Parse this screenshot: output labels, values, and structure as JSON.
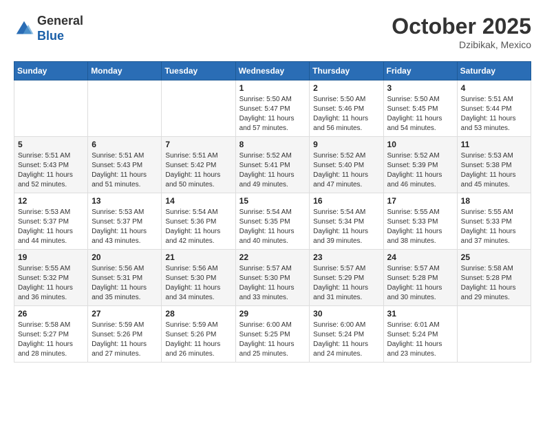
{
  "header": {
    "logo_line1": "General",
    "logo_line2": "Blue",
    "month": "October 2025",
    "location": "Dzibikak, Mexico"
  },
  "weekdays": [
    "Sunday",
    "Monday",
    "Tuesday",
    "Wednesday",
    "Thursday",
    "Friday",
    "Saturday"
  ],
  "weeks": [
    [
      {
        "day": "",
        "info": ""
      },
      {
        "day": "",
        "info": ""
      },
      {
        "day": "",
        "info": ""
      },
      {
        "day": "1",
        "info": "Sunrise: 5:50 AM\nSunset: 5:47 PM\nDaylight: 11 hours\nand 57 minutes."
      },
      {
        "day": "2",
        "info": "Sunrise: 5:50 AM\nSunset: 5:46 PM\nDaylight: 11 hours\nand 56 minutes."
      },
      {
        "day": "3",
        "info": "Sunrise: 5:50 AM\nSunset: 5:45 PM\nDaylight: 11 hours\nand 54 minutes."
      },
      {
        "day": "4",
        "info": "Sunrise: 5:51 AM\nSunset: 5:44 PM\nDaylight: 11 hours\nand 53 minutes."
      }
    ],
    [
      {
        "day": "5",
        "info": "Sunrise: 5:51 AM\nSunset: 5:43 PM\nDaylight: 11 hours\nand 52 minutes."
      },
      {
        "day": "6",
        "info": "Sunrise: 5:51 AM\nSunset: 5:43 PM\nDaylight: 11 hours\nand 51 minutes."
      },
      {
        "day": "7",
        "info": "Sunrise: 5:51 AM\nSunset: 5:42 PM\nDaylight: 11 hours\nand 50 minutes."
      },
      {
        "day": "8",
        "info": "Sunrise: 5:52 AM\nSunset: 5:41 PM\nDaylight: 11 hours\nand 49 minutes."
      },
      {
        "day": "9",
        "info": "Sunrise: 5:52 AM\nSunset: 5:40 PM\nDaylight: 11 hours\nand 47 minutes."
      },
      {
        "day": "10",
        "info": "Sunrise: 5:52 AM\nSunset: 5:39 PM\nDaylight: 11 hours\nand 46 minutes."
      },
      {
        "day": "11",
        "info": "Sunrise: 5:53 AM\nSunset: 5:38 PM\nDaylight: 11 hours\nand 45 minutes."
      }
    ],
    [
      {
        "day": "12",
        "info": "Sunrise: 5:53 AM\nSunset: 5:37 PM\nDaylight: 11 hours\nand 44 minutes."
      },
      {
        "day": "13",
        "info": "Sunrise: 5:53 AM\nSunset: 5:37 PM\nDaylight: 11 hours\nand 43 minutes."
      },
      {
        "day": "14",
        "info": "Sunrise: 5:54 AM\nSunset: 5:36 PM\nDaylight: 11 hours\nand 42 minutes."
      },
      {
        "day": "15",
        "info": "Sunrise: 5:54 AM\nSunset: 5:35 PM\nDaylight: 11 hours\nand 40 minutes."
      },
      {
        "day": "16",
        "info": "Sunrise: 5:54 AM\nSunset: 5:34 PM\nDaylight: 11 hours\nand 39 minutes."
      },
      {
        "day": "17",
        "info": "Sunrise: 5:55 AM\nSunset: 5:33 PM\nDaylight: 11 hours\nand 38 minutes."
      },
      {
        "day": "18",
        "info": "Sunrise: 5:55 AM\nSunset: 5:33 PM\nDaylight: 11 hours\nand 37 minutes."
      }
    ],
    [
      {
        "day": "19",
        "info": "Sunrise: 5:55 AM\nSunset: 5:32 PM\nDaylight: 11 hours\nand 36 minutes."
      },
      {
        "day": "20",
        "info": "Sunrise: 5:56 AM\nSunset: 5:31 PM\nDaylight: 11 hours\nand 35 minutes."
      },
      {
        "day": "21",
        "info": "Sunrise: 5:56 AM\nSunset: 5:30 PM\nDaylight: 11 hours\nand 34 minutes."
      },
      {
        "day": "22",
        "info": "Sunrise: 5:57 AM\nSunset: 5:30 PM\nDaylight: 11 hours\nand 33 minutes."
      },
      {
        "day": "23",
        "info": "Sunrise: 5:57 AM\nSunset: 5:29 PM\nDaylight: 11 hours\nand 31 minutes."
      },
      {
        "day": "24",
        "info": "Sunrise: 5:57 AM\nSunset: 5:28 PM\nDaylight: 11 hours\nand 30 minutes."
      },
      {
        "day": "25",
        "info": "Sunrise: 5:58 AM\nSunset: 5:28 PM\nDaylight: 11 hours\nand 29 minutes."
      }
    ],
    [
      {
        "day": "26",
        "info": "Sunrise: 5:58 AM\nSunset: 5:27 PM\nDaylight: 11 hours\nand 28 minutes."
      },
      {
        "day": "27",
        "info": "Sunrise: 5:59 AM\nSunset: 5:26 PM\nDaylight: 11 hours\nand 27 minutes."
      },
      {
        "day": "28",
        "info": "Sunrise: 5:59 AM\nSunset: 5:26 PM\nDaylight: 11 hours\nand 26 minutes."
      },
      {
        "day": "29",
        "info": "Sunrise: 6:00 AM\nSunset: 5:25 PM\nDaylight: 11 hours\nand 25 minutes."
      },
      {
        "day": "30",
        "info": "Sunrise: 6:00 AM\nSunset: 5:24 PM\nDaylight: 11 hours\nand 24 minutes."
      },
      {
        "day": "31",
        "info": "Sunrise: 6:01 AM\nSunset: 5:24 PM\nDaylight: 11 hours\nand 23 minutes."
      },
      {
        "day": "",
        "info": ""
      }
    ]
  ]
}
